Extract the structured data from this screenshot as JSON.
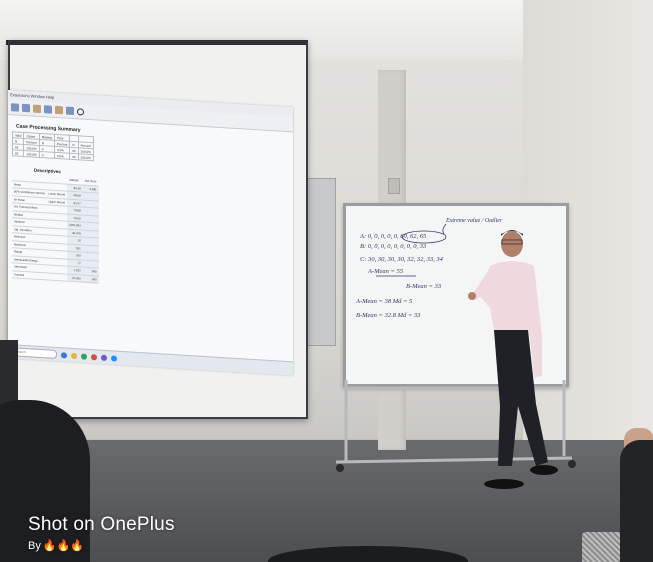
{
  "watermark": {
    "main": "Shot on OnePlus",
    "by": "By",
    "flames": "🔥🔥🔥"
  },
  "projection": {
    "menu": "Extensions  Window  Help",
    "summary_title": "Case Processing Summary",
    "summary_headers": [
      "Valid",
      "Cases",
      "Missing",
      "Total"
    ],
    "summary_sub": [
      "N",
      "Percent",
      "N",
      "Percent",
      "N",
      "Percent"
    ],
    "summary_rows": [
      [
        "65",
        "100.0%",
        "0",
        "0.0%",
        "65",
        "100.0%"
      ],
      [
        "65",
        "100.0%",
        "0",
        "0.0%",
        "65",
        "100.0%"
      ]
    ],
    "descriptives_title": "Descriptives",
    "descriptives_headers": [
      "",
      "",
      "Statistic",
      "Std. Error"
    ],
    "descriptives_rows": [
      [
        "Mean",
        "",
        "80.38",
        "5.841"
      ],
      [
        "95% Confidence Interval",
        "Lower Bound",
        "68.69",
        ""
      ],
      [
        "for Mean",
        "Upper Bound",
        "92.07",
        ""
      ],
      [
        "5% Trimmed Mean",
        "",
        "79.88",
        ""
      ],
      [
        "Median",
        "",
        "75.00",
        ""
      ],
      [
        "Variance",
        "",
        "2150.933",
        ""
      ],
      [
        "Std. Deviation",
        "",
        "46.378",
        ""
      ],
      [
        "Minimum",
        "",
        "10",
        ""
      ],
      [
        "Maximum",
        "",
        "181",
        ""
      ],
      [
        "Range",
        "",
        "200",
        ""
      ],
      [
        "Interquartile Range",
        "",
        "77",
        ""
      ],
      [
        "Skewness",
        "",
        "1.022",
        ".000"
      ],
      [
        "Kurtosis",
        "",
        "21.000",
        ".000"
      ]
    ],
    "taskbar_search": "Search"
  },
  "whiteboard": {
    "lines": [
      "Extreme value / Outlier",
      "A: 0, 0, 0, 0, 0, 60, 62, 65",
      "B: 0, 0, 0, 0, 0, 0, 0, 0, 33",
      "C: 30, 30, 30, 30, 32, 32, 33, 34",
      "A-Mean = 55",
      "B-Mean = 33",
      "A-Mean = 38  Md = 5",
      "B-Mean = 32.8  Md = 33"
    ]
  },
  "colors": {
    "screen_frame": "#3b3d45",
    "whiteboard_frame": "#9a9c9f",
    "shirt": "#efd9df",
    "trousers": "#1f2127",
    "marker_ink": "#2c3a6e"
  }
}
